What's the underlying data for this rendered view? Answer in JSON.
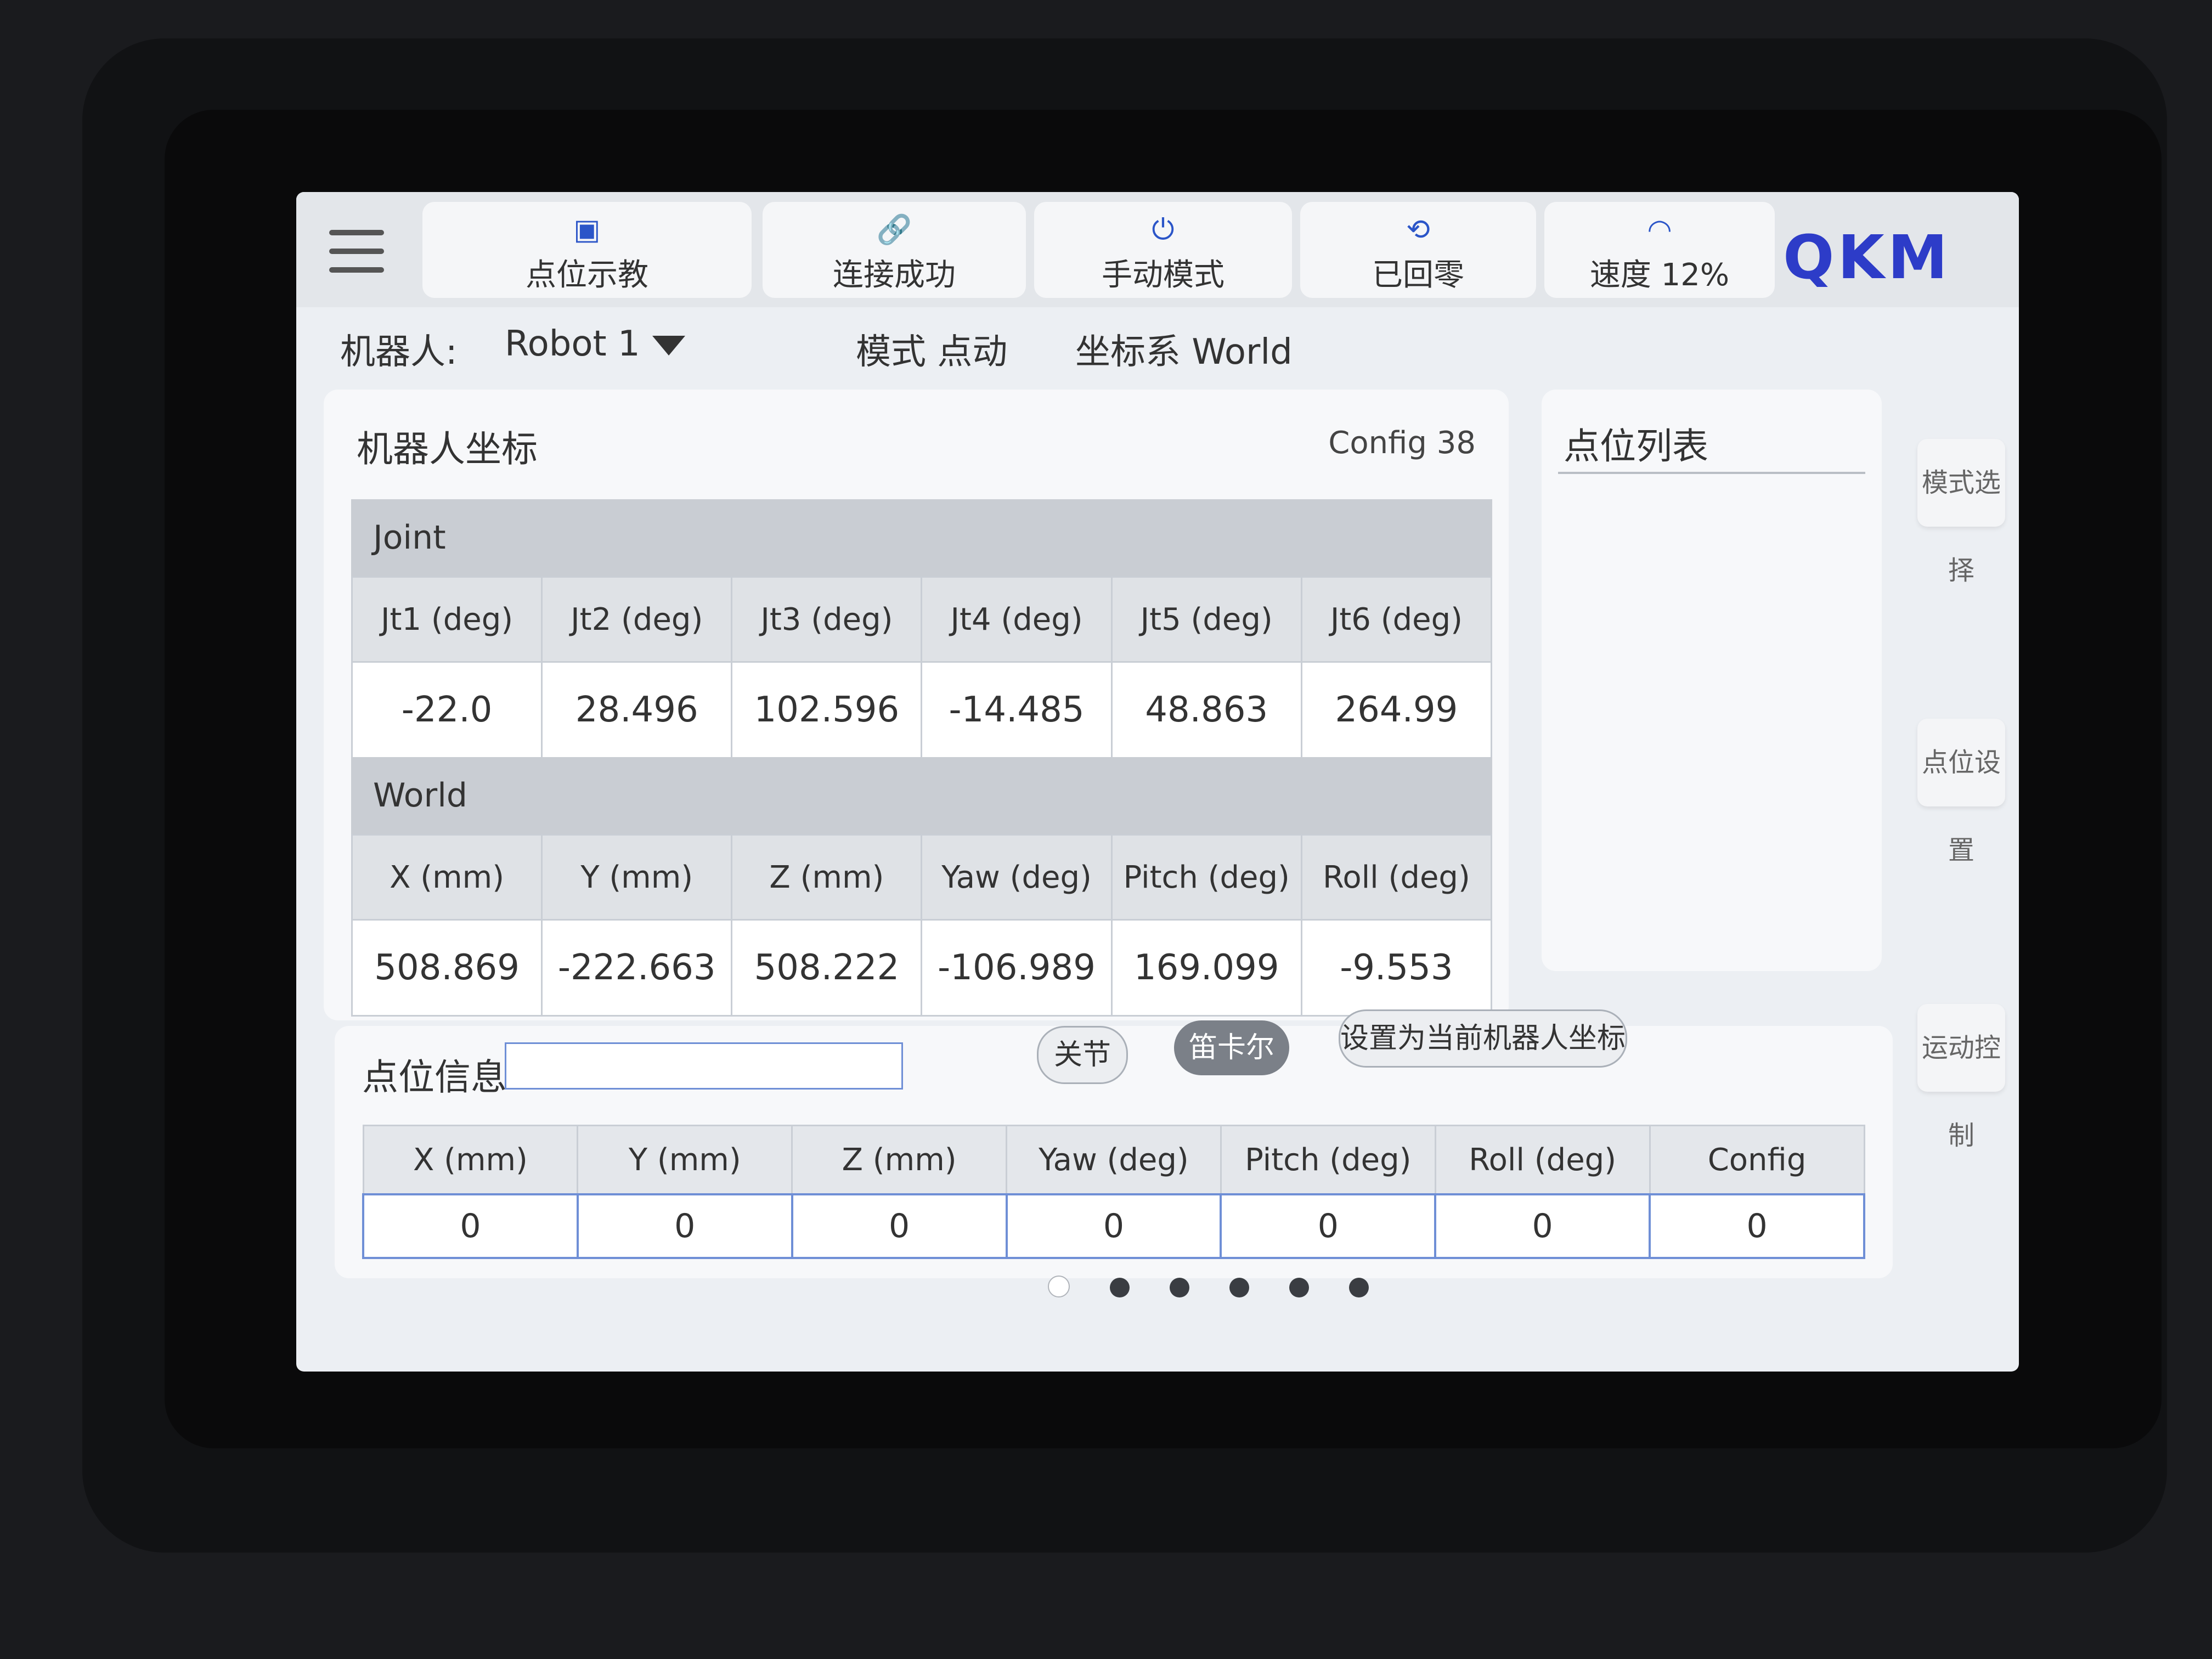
{
  "topbar": {
    "tabs": [
      {
        "label": "点位示教",
        "icon": "teach-icon"
      },
      {
        "label": "连接成功",
        "icon": "link-icon"
      },
      {
        "label": "手动模式",
        "icon": "power-icon"
      },
      {
        "label": "已回零",
        "icon": "homed-icon"
      },
      {
        "label": "速度 12%",
        "icon": "speed-gauge-icon"
      }
    ],
    "logo": "QKM"
  },
  "subbar": {
    "robot_label": "机器人:",
    "robot_value": "Robot 1",
    "mode": "模式 点动",
    "coord": "坐标系 World"
  },
  "robot_coords": {
    "title": "机器人坐标",
    "config": "Config  38",
    "joint": {
      "title": "Joint",
      "headers": [
        "Jt1 (deg)",
        "Jt2 (deg)",
        "Jt3 (deg)",
        "Jt4 (deg)",
        "Jt5 (deg)",
        "Jt6 (deg)"
      ],
      "values": [
        "-22.0",
        "28.496",
        "102.596",
        "-14.485",
        "48.863",
        "264.99"
      ]
    },
    "world": {
      "title": "World",
      "headers": [
        "X (mm)",
        "Y (mm)",
        "Z (mm)",
        "Yaw (deg)",
        "Pitch (deg)",
        "Roll (deg)"
      ],
      "values": [
        "508.869",
        "-222.663",
        "508.222",
        "-106.989",
        "169.099",
        "-9.553"
      ]
    }
  },
  "point_list": {
    "title": "点位列表"
  },
  "side_buttons": [
    "模式选择",
    "点位设置",
    "运动控制"
  ],
  "point_info": {
    "title": "点位信息",
    "input_value": "",
    "btn_joint": "关节",
    "btn_cartesian": "笛卡尔",
    "btn_set_current": "设置为当前机器人坐标",
    "headers": [
      "X (mm)",
      "Y (mm)",
      "Z (mm)",
      "Yaw (deg)",
      "Pitch (deg)",
      "Roll (deg)",
      "Config"
    ],
    "values": [
      "0",
      "0",
      "0",
      "0",
      "0",
      "0",
      "0"
    ]
  },
  "pager": {
    "count": 6,
    "active": 0
  }
}
